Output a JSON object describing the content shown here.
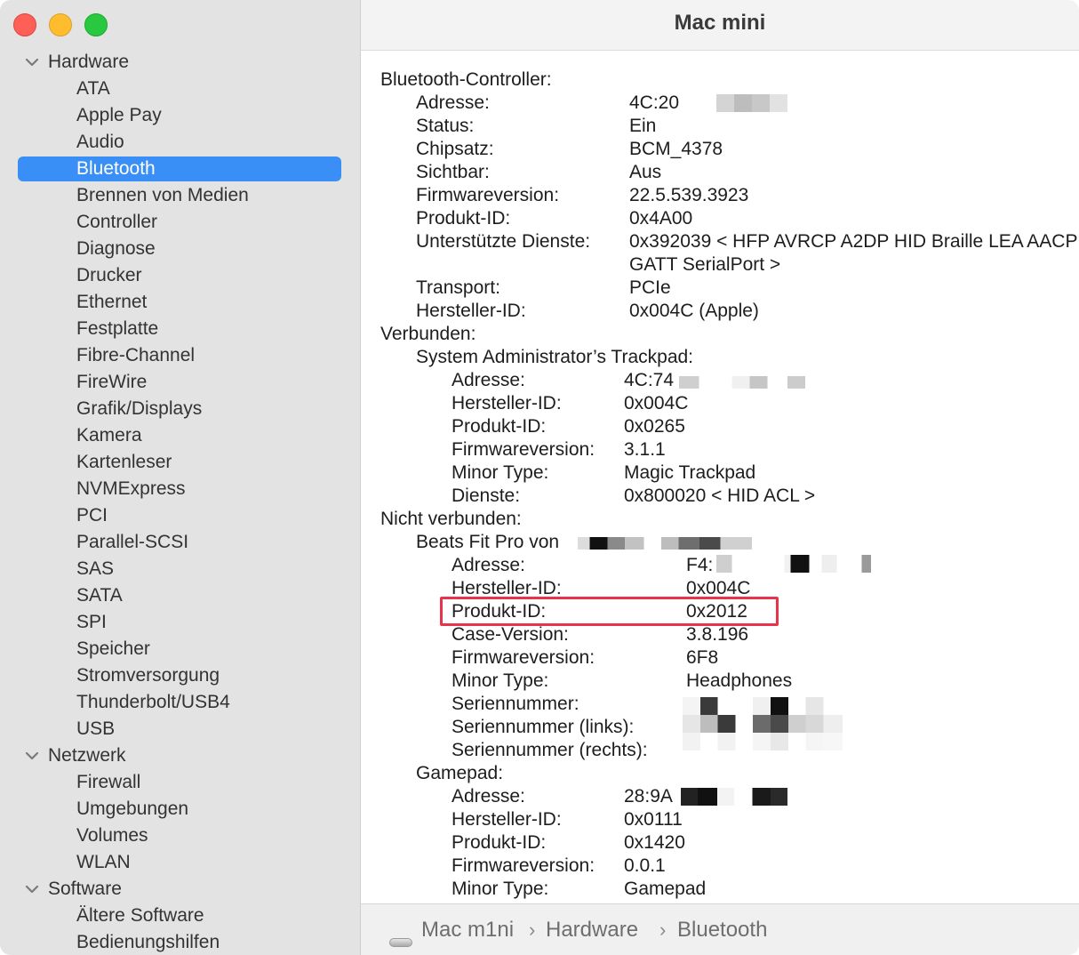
{
  "window": {
    "title": "Mac mini"
  },
  "sidebar": {
    "groups": [
      {
        "label": "Hardware",
        "items": [
          "ATA",
          "Apple Pay",
          "Audio",
          "Bluetooth",
          "Brennen von Medien",
          "Controller",
          "Diagnose",
          "Drucker",
          "Ethernet",
          "Festplatte",
          "Fibre-Channel",
          "FireWire",
          "Grafik/Displays",
          "Kamera",
          "Kartenleser",
          "NVMExpress",
          "PCI",
          "Parallel-SCSI",
          "SAS",
          "SATA",
          "SPI",
          "Speicher",
          "Stromversorgung",
          "Thunderbolt/USB4",
          "USB"
        ]
      },
      {
        "label": "Netzwerk",
        "items": [
          "Firewall",
          "Umgebungen",
          "Volumes",
          "WLAN"
        ]
      },
      {
        "label": "Software",
        "items": [
          "Ältere Software",
          "Bedienungshilfen"
        ]
      }
    ],
    "selected": "Bluetooth"
  },
  "content": {
    "controller": {
      "heading": "Bluetooth-Controller:",
      "rows": [
        {
          "label": "Adresse:",
          "value": "4C:20"
        },
        {
          "label": "Status:",
          "value": "Ein"
        },
        {
          "label": "Chipsatz:",
          "value": "BCM_4378"
        },
        {
          "label": "Sichtbar:",
          "value": "Aus"
        },
        {
          "label": "Firmwareversion:",
          "value": "22.5.539.3923"
        },
        {
          "label": "Produkt-ID:",
          "value": "0x4A00"
        },
        {
          "label": "Unterstützte Dienste:",
          "value": "0x392039 < HFP AVRCP A2DP HID Braille LEA AACP",
          "value2": "GATT SerialPort >"
        },
        {
          "label": "Transport:",
          "value": "PCIe"
        },
        {
          "label": "Hersteller-ID:",
          "value": "0x004C (Apple)"
        }
      ]
    },
    "connected": {
      "heading": "Verbunden:",
      "device": "System Administrator’s Trackpad:",
      "rows": [
        {
          "label": "Adresse:",
          "value": "4C:74"
        },
        {
          "label": "Hersteller-ID:",
          "value": "0x004C"
        },
        {
          "label": "Produkt-ID:",
          "value": "0x0265"
        },
        {
          "label": "Firmwareversion:",
          "value": "3.1.1"
        },
        {
          "label": "Minor Type:",
          "value": "Magic Trackpad"
        },
        {
          "label": "Dienste:",
          "value": "0x800020 < HID ACL >"
        }
      ]
    },
    "not_connected": {
      "heading": "Nicht verbunden:",
      "device1": "Beats Fit Pro von",
      "rows1": [
        {
          "label": "Adresse:",
          "value": "F4:"
        },
        {
          "label": "Hersteller-ID:",
          "value": "0x004C"
        },
        {
          "label": "Produkt-ID:",
          "value": "0x2012"
        },
        {
          "label": "Case-Version:",
          "value": "3.8.196"
        },
        {
          "label": "Firmwareversion:",
          "value": "6F8"
        },
        {
          "label": "Minor Type:",
          "value": "Headphones"
        },
        {
          "label": "Seriennummer:",
          "value": ""
        },
        {
          "label": "Seriennummer (links):",
          "value": ""
        },
        {
          "label": "Seriennummer (rechts):",
          "value": ""
        }
      ],
      "device2": "Gamepad:",
      "rows2": [
        {
          "label": "Adresse:",
          "value": "28:9A"
        },
        {
          "label": "Hersteller-ID:",
          "value": "0x0111"
        },
        {
          "label": "Produkt-ID:",
          "value": "0x1420"
        },
        {
          "label": "Firmwareversion:",
          "value": "0.0.1"
        },
        {
          "label": "Minor Type:",
          "value": "Gamepad"
        }
      ]
    }
  },
  "breadcrumb": [
    "Mac m1ni",
    "Hardware",
    "Bluetooth"
  ],
  "colors": {
    "selection": "#3a8ff7",
    "highlight_box": "#e8344a"
  }
}
